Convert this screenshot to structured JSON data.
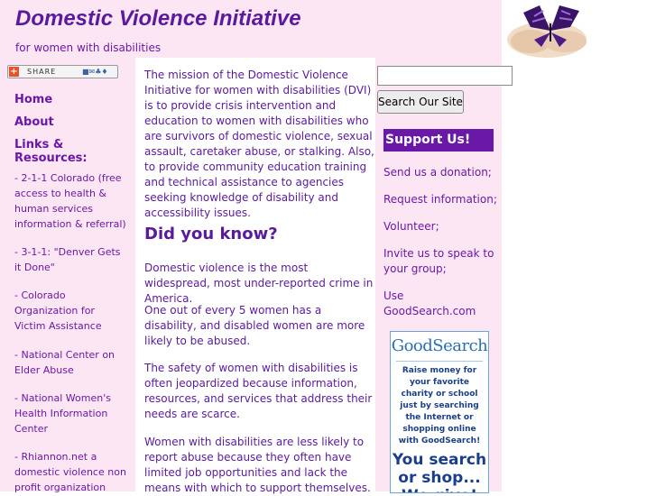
{
  "header": {
    "title": "Domestic Violence Initiative",
    "tagline": "for women with disabilities"
  },
  "share": {
    "label": "SHARE"
  },
  "sidebar": {
    "nav": [
      {
        "label": "Home"
      },
      {
        "label": "About"
      },
      {
        "label": "Links & Resources:"
      }
    ],
    "links": [
      {
        "label": "- 2-1-1 Colorado (free access to health & human services information & referral)"
      },
      {
        "label": "- 3-1-1: \"Denver Gets it Done\""
      },
      {
        "label": "- Colorado Organization for Victim Assistance"
      },
      {
        "label": "- National Center on Elder Abuse"
      },
      {
        "label": "- National Women's Health Information Center"
      },
      {
        "label": "- Rhiannon.net a domestic violence non profit organization"
      }
    ]
  },
  "main": {
    "mission": "The mission of the Domestic Violence Initiative for women with disabilities (DVI) is to provide crisis intervention and education to women with disabilities who are survivors of domestic violence, sexual assault, caretaker abuse, or stalking. Also, to provide community education training and technical assistance to agencies seeking knowledge of disability and accessibility issues.",
    "heading": "Did you know?",
    "facts": [
      "Domestic violence is the most widespread, most under-reported crime in America.",
      "One out of every 5 women has a disability, and disabled women are more likely to be abused.",
      "The safety of women with disabilities is often jeopardized because information, resources, and services that address their needs are scarce.",
      "Women with disabilities are less likely to report abuse because they often have limited job opportunities and lack the means with which to support themselves."
    ]
  },
  "search": {
    "value": "",
    "button_label": "Search Our Site"
  },
  "support": {
    "heading": "Support Us!",
    "items": [
      {
        "prefix": "Send us a ",
        "link": "donation",
        "suffix": ";"
      },
      {
        "prefix": "Request ",
        "link": "information",
        "suffix": ";"
      },
      {
        "prefix": "",
        "link": "Volunteer",
        "suffix": ";"
      },
      {
        "prefix": "Invite us ",
        "link": "to speak to your group",
        "suffix": ";"
      },
      {
        "prefix": "Use ",
        "link": "GoodSearch.com",
        "suffix": ""
      }
    ]
  },
  "goodsearch": {
    "logo": "GoodSearch",
    "body": "Raise money for your favorite charity or school just by searching the Internet or shopping online with GoodSearch!",
    "big": "You search or shop... We give!"
  },
  "colors": {
    "brand_purple": "#5a1a9c",
    "link_purple": "#6a18a8",
    "panel_pink": "#fde6f4",
    "goodsearch_blue": "#2b6fb5"
  },
  "icons": {
    "share": "share-plus-icon",
    "butterfly": "butterfly-logo"
  }
}
